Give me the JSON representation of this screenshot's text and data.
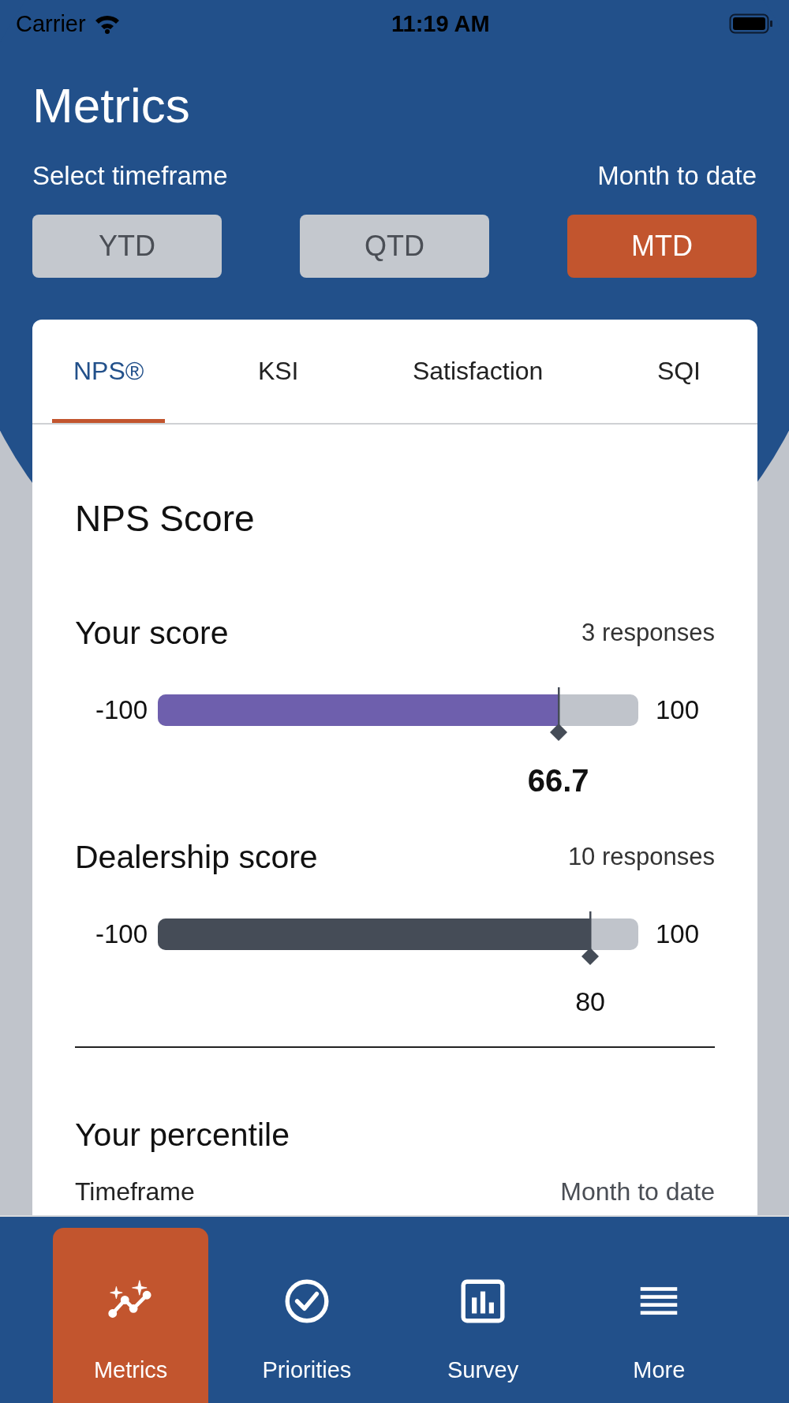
{
  "status_bar": {
    "carrier": "Carrier",
    "time": "11:19 AM"
  },
  "header": {
    "title": "Metrics",
    "timeframe_label": "Select timeframe",
    "timeframe_value": "Month to date"
  },
  "timeframe_buttons": [
    {
      "label": "YTD",
      "selected": false
    },
    {
      "label": "QTD",
      "selected": false
    },
    {
      "label": "MTD",
      "selected": true
    }
  ],
  "tabs": [
    {
      "label": "NPS®",
      "selected": true
    },
    {
      "label": "KSI",
      "selected": false
    },
    {
      "label": "Satisfaction",
      "selected": false
    },
    {
      "label": "SQI",
      "selected": false
    }
  ],
  "section_title": "NPS Score",
  "scores": [
    {
      "label": "Your score",
      "responses": "3 responses",
      "min": "-100",
      "max": "100",
      "value": "66.7",
      "level": 0.8335,
      "color": "#6e5fad",
      "emphasis": true
    },
    {
      "label": "Dealership score",
      "responses": "10 responses",
      "min": "-100",
      "max": "100",
      "value": "80",
      "level": 0.9,
      "color": "#454c57",
      "emphasis": false
    }
  ],
  "percentile": {
    "title": "Your percentile",
    "rows": [
      {
        "label": "Timeframe",
        "value": "Month to date"
      }
    ]
  },
  "nav": [
    {
      "label": "Metrics",
      "kind": "trend",
      "selected": true
    },
    {
      "label": "Priorities",
      "kind": "check",
      "selected": false
    },
    {
      "label": "Survey",
      "kind": "chart",
      "selected": false
    },
    {
      "label": "More",
      "kind": "menu",
      "selected": false
    }
  ]
}
